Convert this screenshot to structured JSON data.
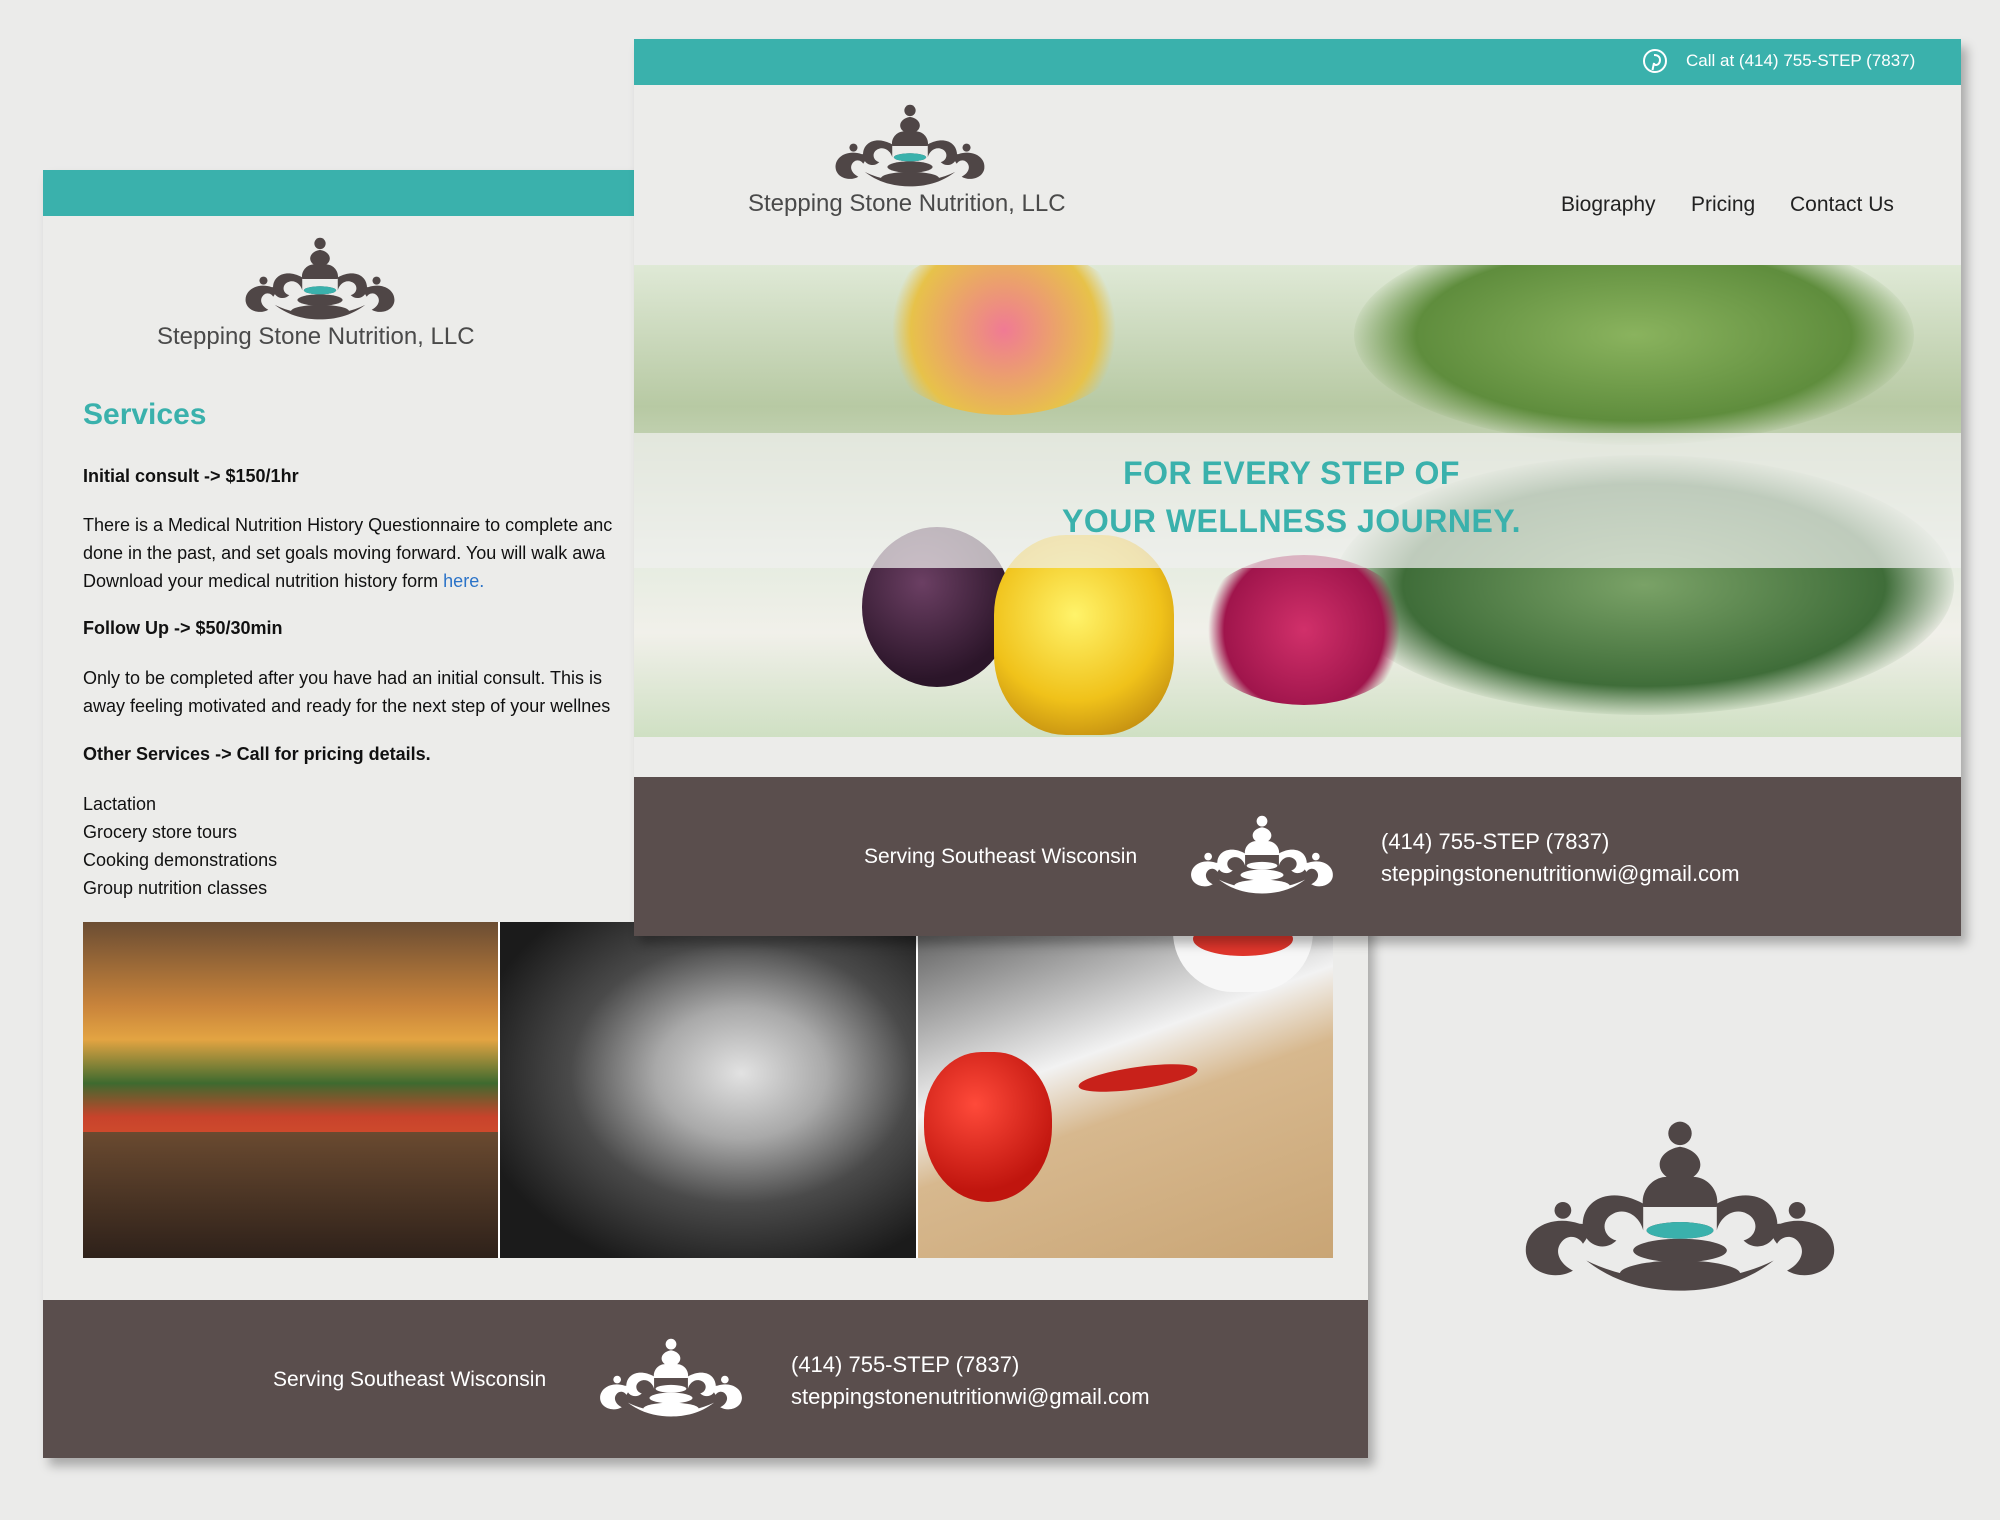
{
  "colors": {
    "accent": "#3ab1ac",
    "footer": "#5a4e4d",
    "logo": "#4f4646",
    "link": "#2b73c8"
  },
  "brand": {
    "name": "Stepping Stone Nutrition, LLC",
    "logo_icon": "stacked-stones-ornament-icon"
  },
  "services_page": {
    "title": "Services",
    "initial": {
      "heading": "Initial consult -> $150/1hr",
      "line1": "There is a Medical Nutrition History Questionnaire to complete anc",
      "line2": "done in the past, and set goals moving forward. You will walk awa",
      "line3": "Download your medical nutrition history form",
      "link": "here."
    },
    "followup": {
      "heading": "Follow Up -> $50/30min",
      "line1": "Only to be completed after you have had an initial consult. This is",
      "line2": "away feeling motivated and ready for the next step of your wellnes"
    },
    "other": {
      "heading": "Other Services -> Call for pricing details.",
      "items": [
        "Lactation",
        "Grocery store tours",
        "Cooking demonstrations",
        "Group nutrition classes"
      ]
    },
    "photos": [
      "produce-market-photo",
      "breastfeeding-photo",
      "cooking-peppers-photo"
    ]
  },
  "home_page": {
    "call": "Call at (414) 755-STEP (7837)",
    "nav": [
      "Biography",
      "Pricing",
      "Contact Us"
    ],
    "hero": {
      "line1": "FOR EVERY STEP OF",
      "line2": "YOUR WELLNESS JOURNEY."
    }
  },
  "footer": {
    "serving": "Serving Southeast Wisconsin",
    "phone": "(414) 755-STEP (7837)",
    "email": "steppingstonenutritionwi@gmail.com"
  }
}
